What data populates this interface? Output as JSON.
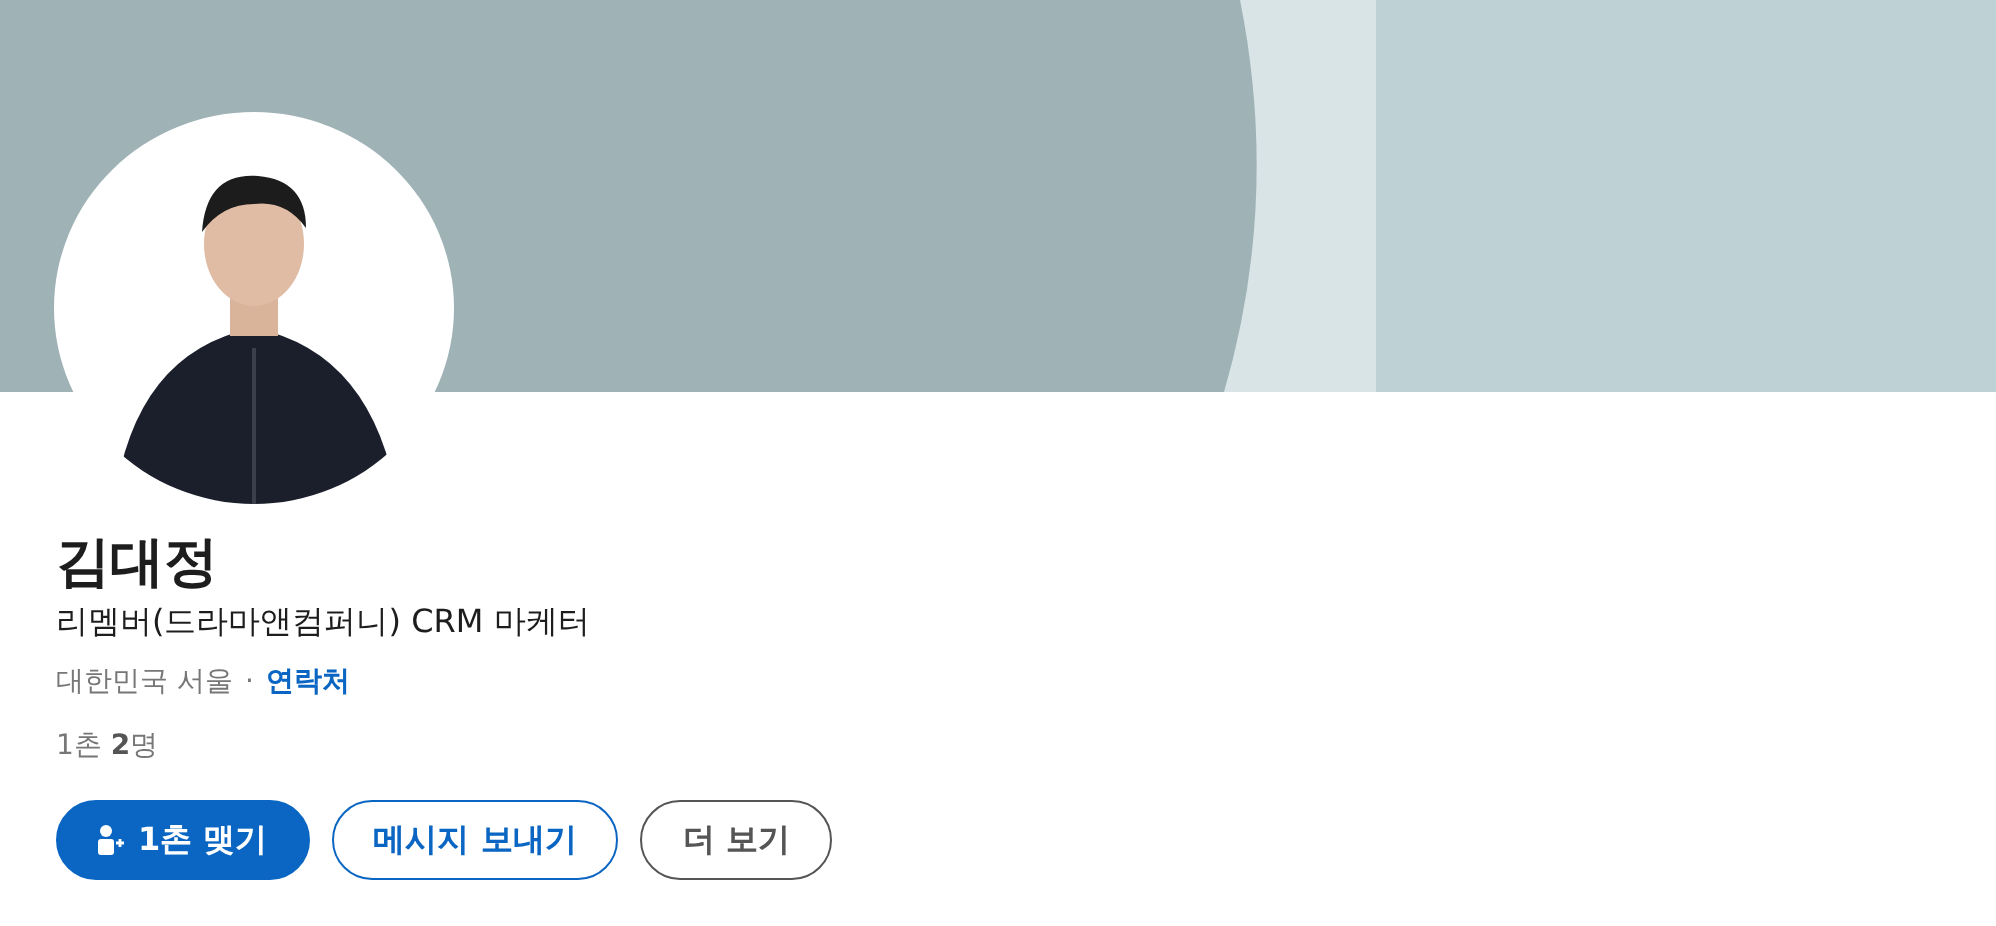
{
  "profile": {
    "name": "김대정",
    "headline": "리멤버(드라마앤컴퍼니) CRM 마케터",
    "location": "대한민국 서울",
    "separator": "·",
    "contact_link": "연락처",
    "connections": "1촌 **2**명"
  },
  "actions": [
    {
      "label": "1촌 맺기",
      "kind": "primary"
    },
    {
      "label": "메시지 보내기",
      "kind": "secondary"
    },
    {
      "label": "더 보기",
      "kind": "tertiary"
    }
  ]
}
